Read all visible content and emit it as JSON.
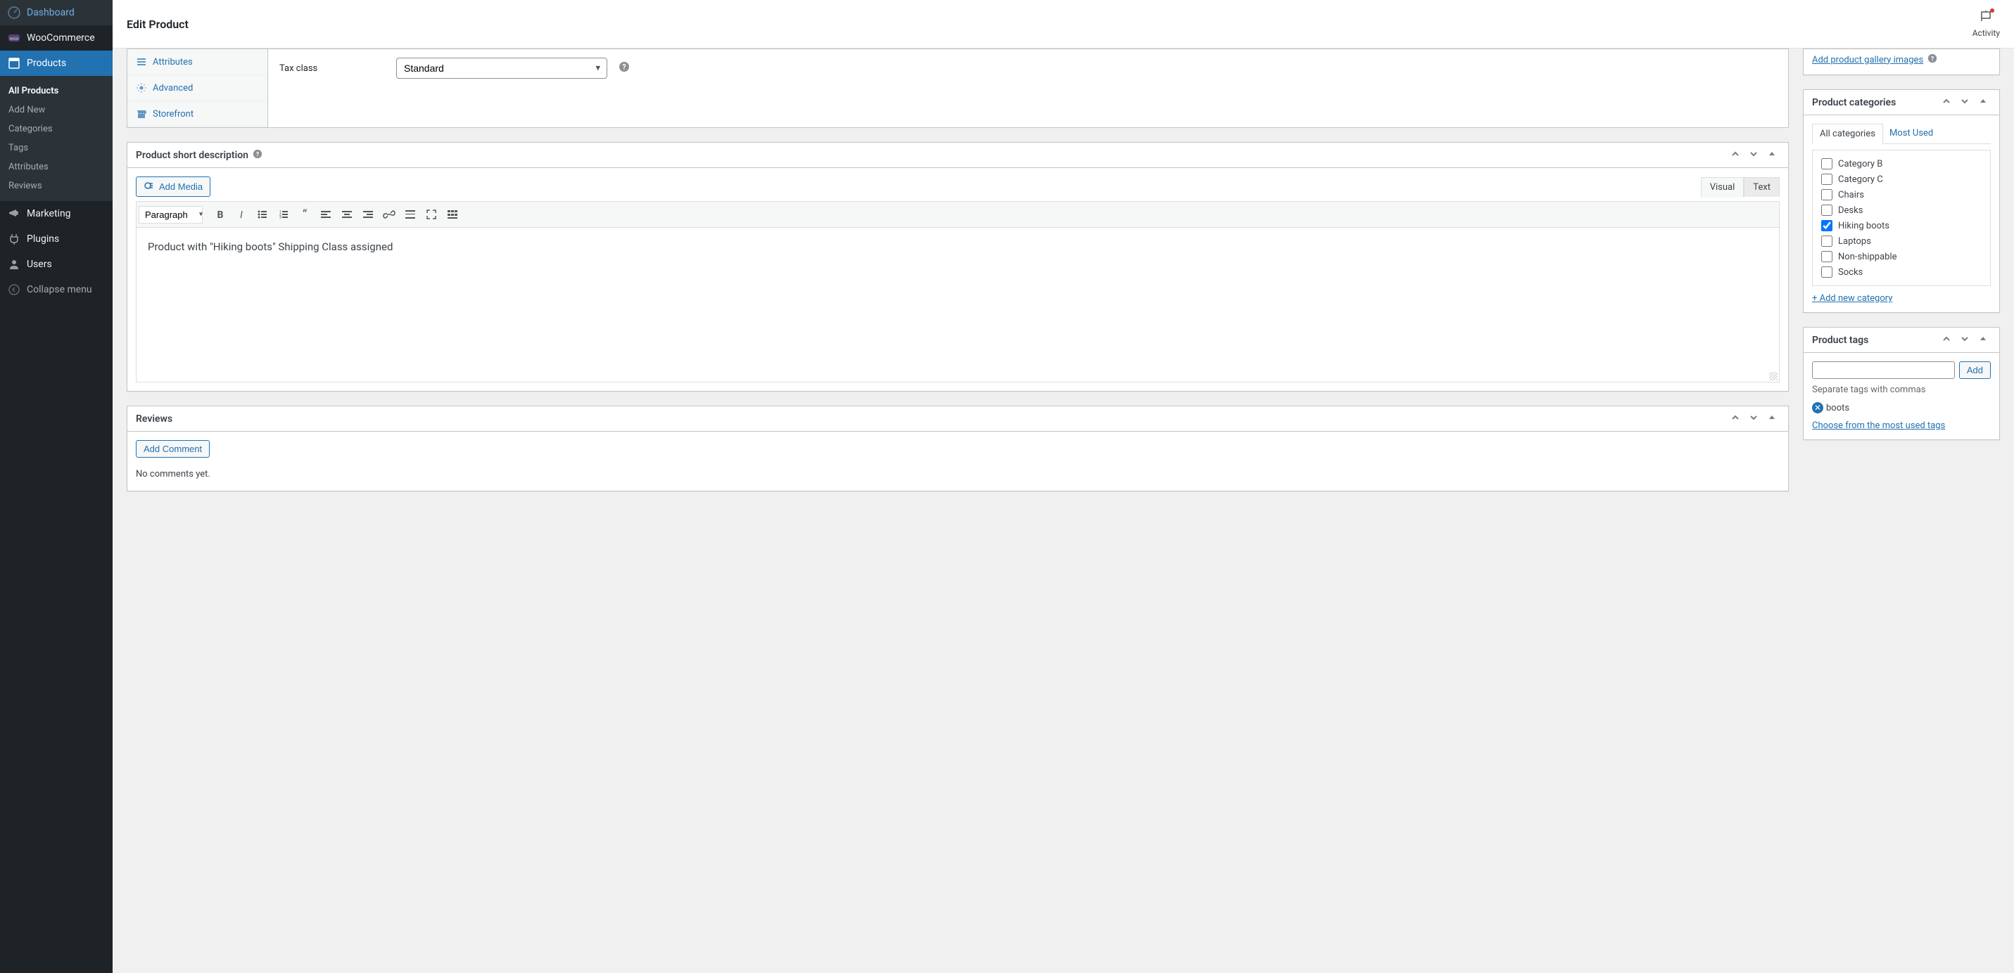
{
  "sidebar": {
    "items": [
      {
        "label": "Dashboard",
        "icon": "dashboard"
      },
      {
        "label": "WooCommerce",
        "icon": "woo"
      },
      {
        "label": "Products",
        "icon": "products",
        "active": true
      },
      {
        "label": "Marketing",
        "icon": "megaphone"
      },
      {
        "label": "Plugins",
        "icon": "plug"
      },
      {
        "label": "Users",
        "icon": "user"
      }
    ],
    "submenu": [
      {
        "label": "All Products",
        "current": true
      },
      {
        "label": "Add New"
      },
      {
        "label": "Categories"
      },
      {
        "label": "Tags"
      },
      {
        "label": "Attributes"
      },
      {
        "label": "Reviews"
      }
    ],
    "collapse_label": "Collapse menu"
  },
  "header": {
    "page_title": "Edit Product",
    "activity_label": "Activity"
  },
  "product_data": {
    "tabs": [
      {
        "label": "Attributes",
        "icon": "list"
      },
      {
        "label": "Advanced",
        "icon": "gear"
      },
      {
        "label": "Storefront",
        "icon": "store"
      }
    ],
    "tax_class_label": "Tax class",
    "tax_class_value": "Standard"
  },
  "short_desc": {
    "title": "Product short description",
    "add_media_label": "Add Media",
    "visual_tab": "Visual",
    "text_tab": "Text",
    "format_value": "Paragraph",
    "content": "Product with \"Hiking boots\" Shipping Class assigned"
  },
  "reviews": {
    "title": "Reviews",
    "add_comment_label": "Add Comment",
    "empty_text": "No comments yet."
  },
  "gallery": {
    "add_link": "Add product gallery images"
  },
  "categories": {
    "title": "Product categories",
    "tab_all": "All categories",
    "tab_most": "Most Used",
    "items": [
      {
        "label": "Category B",
        "checked": false
      },
      {
        "label": "Category C",
        "checked": false
      },
      {
        "label": "Chairs",
        "checked": false
      },
      {
        "label": "Desks",
        "checked": false
      },
      {
        "label": "Hiking boots",
        "checked": true
      },
      {
        "label": "Laptops",
        "checked": false
      },
      {
        "label": "Non-shippable",
        "checked": false
      },
      {
        "label": "Socks",
        "checked": false
      }
    ],
    "add_new_label": "+ Add new category"
  },
  "tags": {
    "title": "Product tags",
    "add_label": "Add",
    "note": "Separate tags with commas",
    "chip": "boots",
    "most_used_link": "Choose from the most used tags"
  }
}
